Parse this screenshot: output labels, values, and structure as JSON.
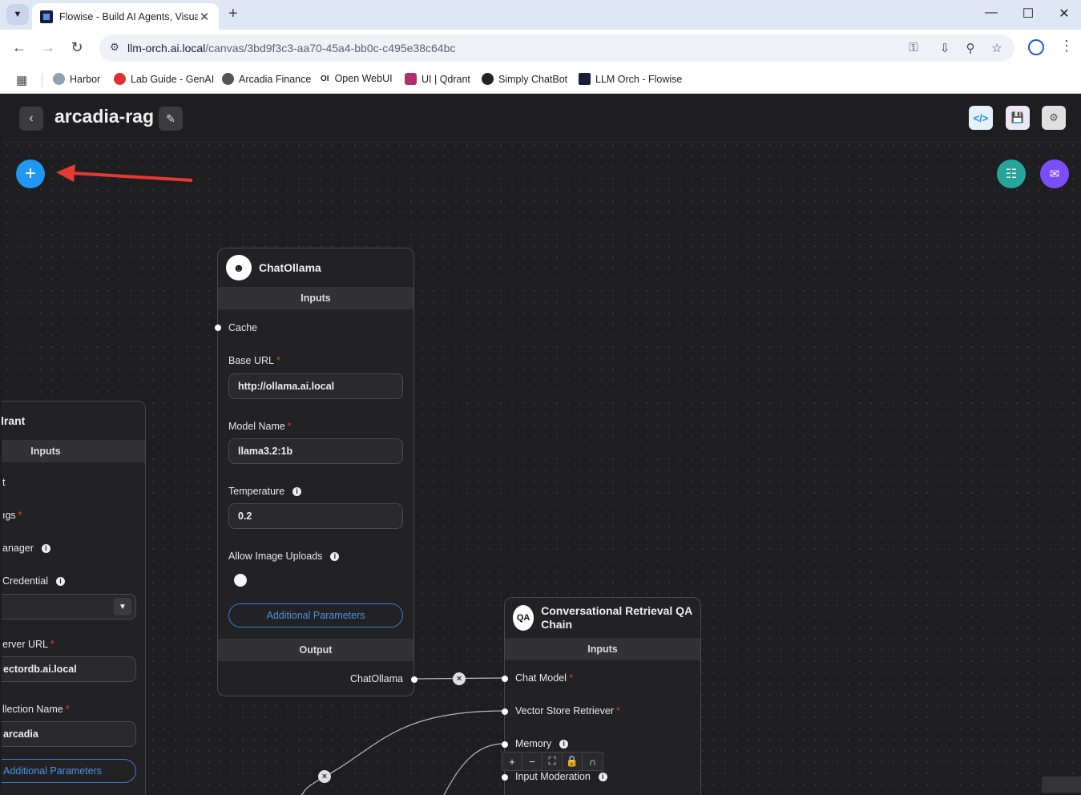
{
  "browser": {
    "tab_title": "Flowise - Build AI Agents, Visua",
    "url_host": "llm-orch.ai.local",
    "url_path": "/canvas/3bd9f3c3-aa70-45a4-bb0c-c495e38c64bc",
    "bookmarks": [
      {
        "label": "Harbor",
        "color": "#8ea0b5"
      },
      {
        "label": "Lab Guide - GenAI",
        "color": "#e03030"
      },
      {
        "label": "Arcadia Finance",
        "color": "#555555"
      },
      {
        "label": "Open WebUI",
        "color": "#222222"
      },
      {
        "label": "UI | Qdrant",
        "color": "#b0306e"
      },
      {
        "label": "Simply ChatBot",
        "color": "#222222"
      },
      {
        "label": "LLM Orch - Flowise",
        "color": "#1a1f36"
      }
    ]
  },
  "app": {
    "title": "arcadia-rag",
    "accent_blue": "#2196f3",
    "accent_green": "#26a69a",
    "accent_purple": "#7c4dff"
  },
  "chat_ollama": {
    "title": "ChatOllama",
    "inputs_label": "Inputs",
    "cache_label": "Cache",
    "base_url_label": "Base URL",
    "base_url_value": "http://ollama.ai.local",
    "model_name_label": "Model Name",
    "model_name_value": "llama3.2:1b",
    "temperature_label": "Temperature",
    "temperature_value": "0.2",
    "allow_uploads_label": "Allow Image Uploads",
    "allow_uploads_on": false,
    "additional_params": "Additional Parameters",
    "output_label": "Output",
    "output_name": "ChatOllama"
  },
  "qdrant": {
    "title": "lrant",
    "inputs_label": "Inputs",
    "row1": "t",
    "row2": "ıgs",
    "row3": "anager",
    "row4": "Credential",
    "server_url_label": "erver URL",
    "server_url_value": "ectordb.ai.local",
    "collection_label": "llection Name",
    "collection_value": "arcadia",
    "additional_params": "Additional Parameters"
  },
  "qa_chain": {
    "title": "Conversational Retrieval QA Chain",
    "inputs_label": "Inputs",
    "chat_model_label": "Chat Model",
    "retriever_label": "Vector Store Retriever",
    "memory_label": "Memory",
    "input_moderation_label": "Input Moderation"
  }
}
